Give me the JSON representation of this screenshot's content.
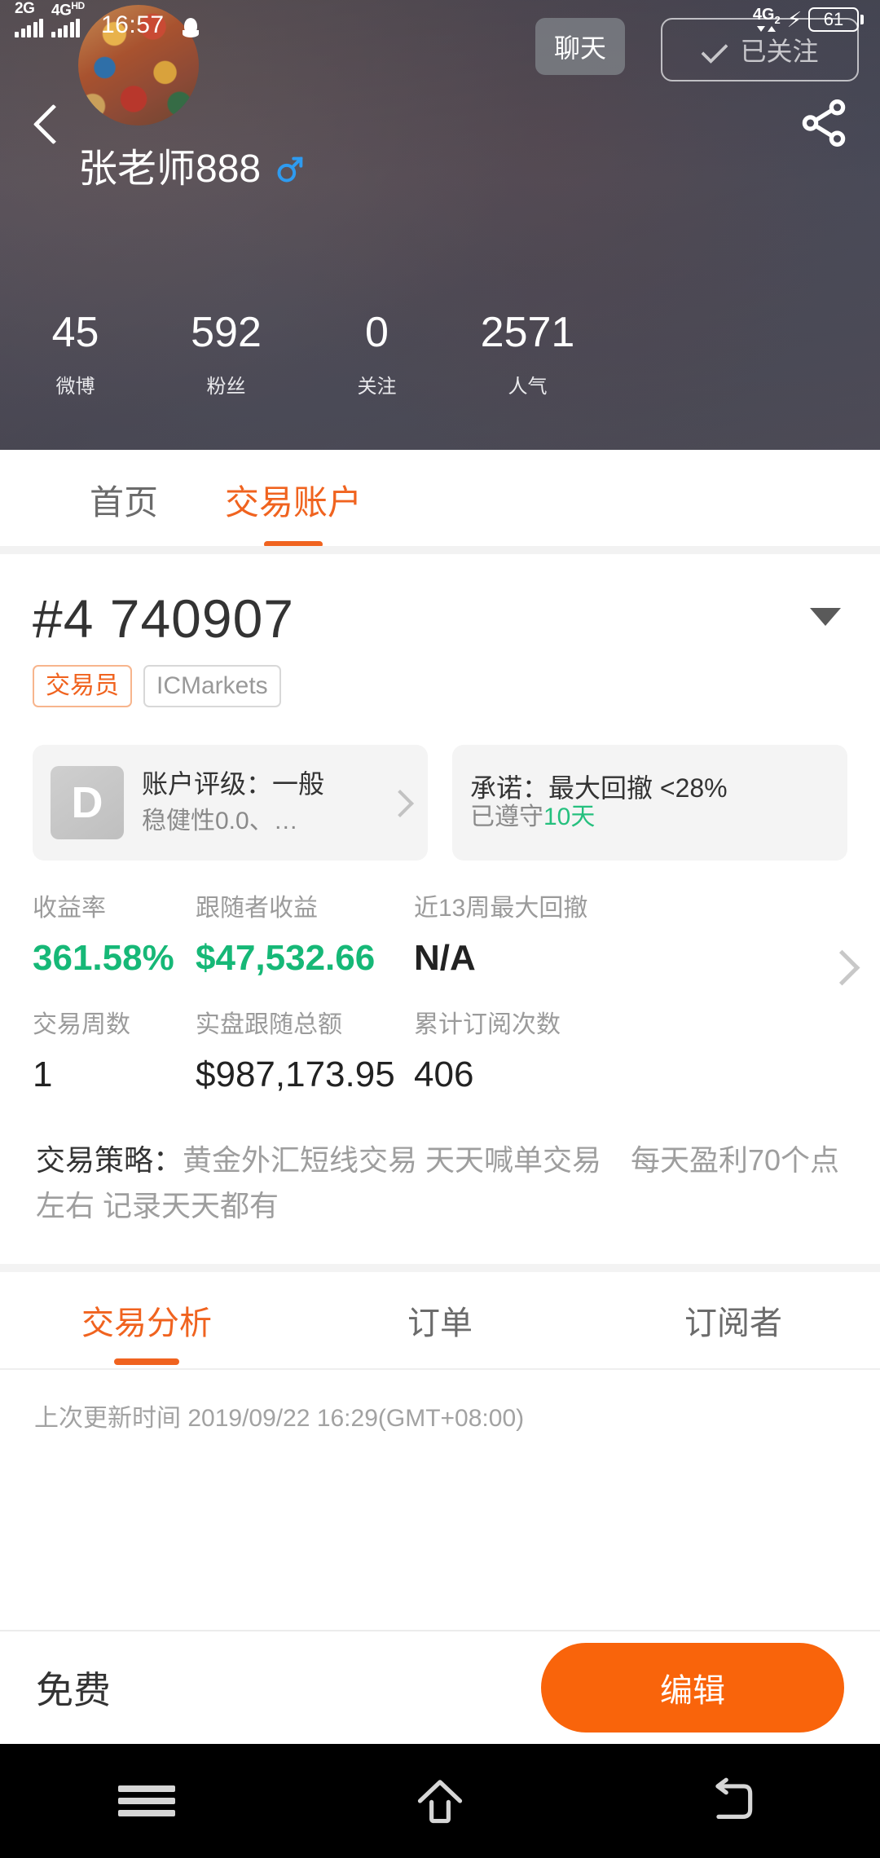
{
  "status_bar": {
    "signal1_label": "2G",
    "signal2_label": "4G",
    "signal2_sup": "HD",
    "time": "16:57",
    "qq_icon": "qq-penguin-icon",
    "net_label": "4G",
    "net_sub": "2",
    "bolt_icon": "charging-bolt-icon",
    "battery_level": "61"
  },
  "profile": {
    "back_icon": "back-arrow-icon",
    "share_icon": "share-icon",
    "avatar": "user-avatar",
    "username": "张老师888",
    "gender_icon": "male-gender-icon",
    "chat_label": "聊天",
    "follow_label": "已关注",
    "follow_check_icon": "check-icon",
    "stats": [
      {
        "value": "45",
        "label": "微博"
      },
      {
        "value": "592",
        "label": "粉丝"
      },
      {
        "value": "0",
        "label": "关注"
      },
      {
        "value": "2571",
        "label": "人气"
      }
    ]
  },
  "top_tabs": [
    {
      "label": "首页",
      "active": false
    },
    {
      "label": "交易账户",
      "active": true
    }
  ],
  "account": {
    "number": "#4 740907",
    "caret_icon": "chevron-down-icon",
    "badge_trader": "交易员",
    "badge_broker": "ICMarkets"
  },
  "cards": {
    "rating": {
      "grade": "D",
      "title": "账户评级：一般",
      "subtitle": "稳健性0.0、…",
      "chevron_icon": "chevron-right-icon"
    },
    "promise": {
      "title": "承诺：最大回撤 <28%",
      "sub_prefix": "已遵守",
      "sub_value": "10天"
    }
  },
  "metrics": {
    "chevron_icon": "chevron-right-icon",
    "row1": [
      {
        "label": "收益率",
        "value": "361.58%",
        "style": "gain"
      },
      {
        "label": "跟随者收益",
        "value": "$47,532.66",
        "style": "gain"
      },
      {
        "label": "近13周最大回撤",
        "value": "N/A",
        "style": "plain"
      }
    ],
    "row2": [
      {
        "label": "交易周数",
        "value": "1",
        "style": "plain"
      },
      {
        "label": "实盘跟随总额",
        "value": "$987,173.95",
        "style": "plain"
      },
      {
        "label": "累计订阅次数",
        "value": "406",
        "style": "plain"
      }
    ]
  },
  "strategy": {
    "label": "交易策略：",
    "text": "黄金外汇短线交易 天天喊单交易　每天盈利70个点左右 记录天天都有"
  },
  "bottom_tabs": [
    {
      "label": "交易分析",
      "active": true
    },
    {
      "label": "订单",
      "active": false
    },
    {
      "label": "订阅者",
      "active": false
    }
  ],
  "updated_text": "上次更新时间 2019/09/22 16:29(GMT+08:00)",
  "action_bar": {
    "free_label": "免费",
    "edit_label": "编辑"
  },
  "nav_bar": {
    "menu_icon": "menu-icon",
    "home_icon": "home-icon",
    "back_icon": "back-icon"
  },
  "colors": {
    "accent": "#f0631f",
    "edit_button": "#f9640b",
    "gain_green": "#16b877",
    "promise_green": "#25c07e"
  }
}
